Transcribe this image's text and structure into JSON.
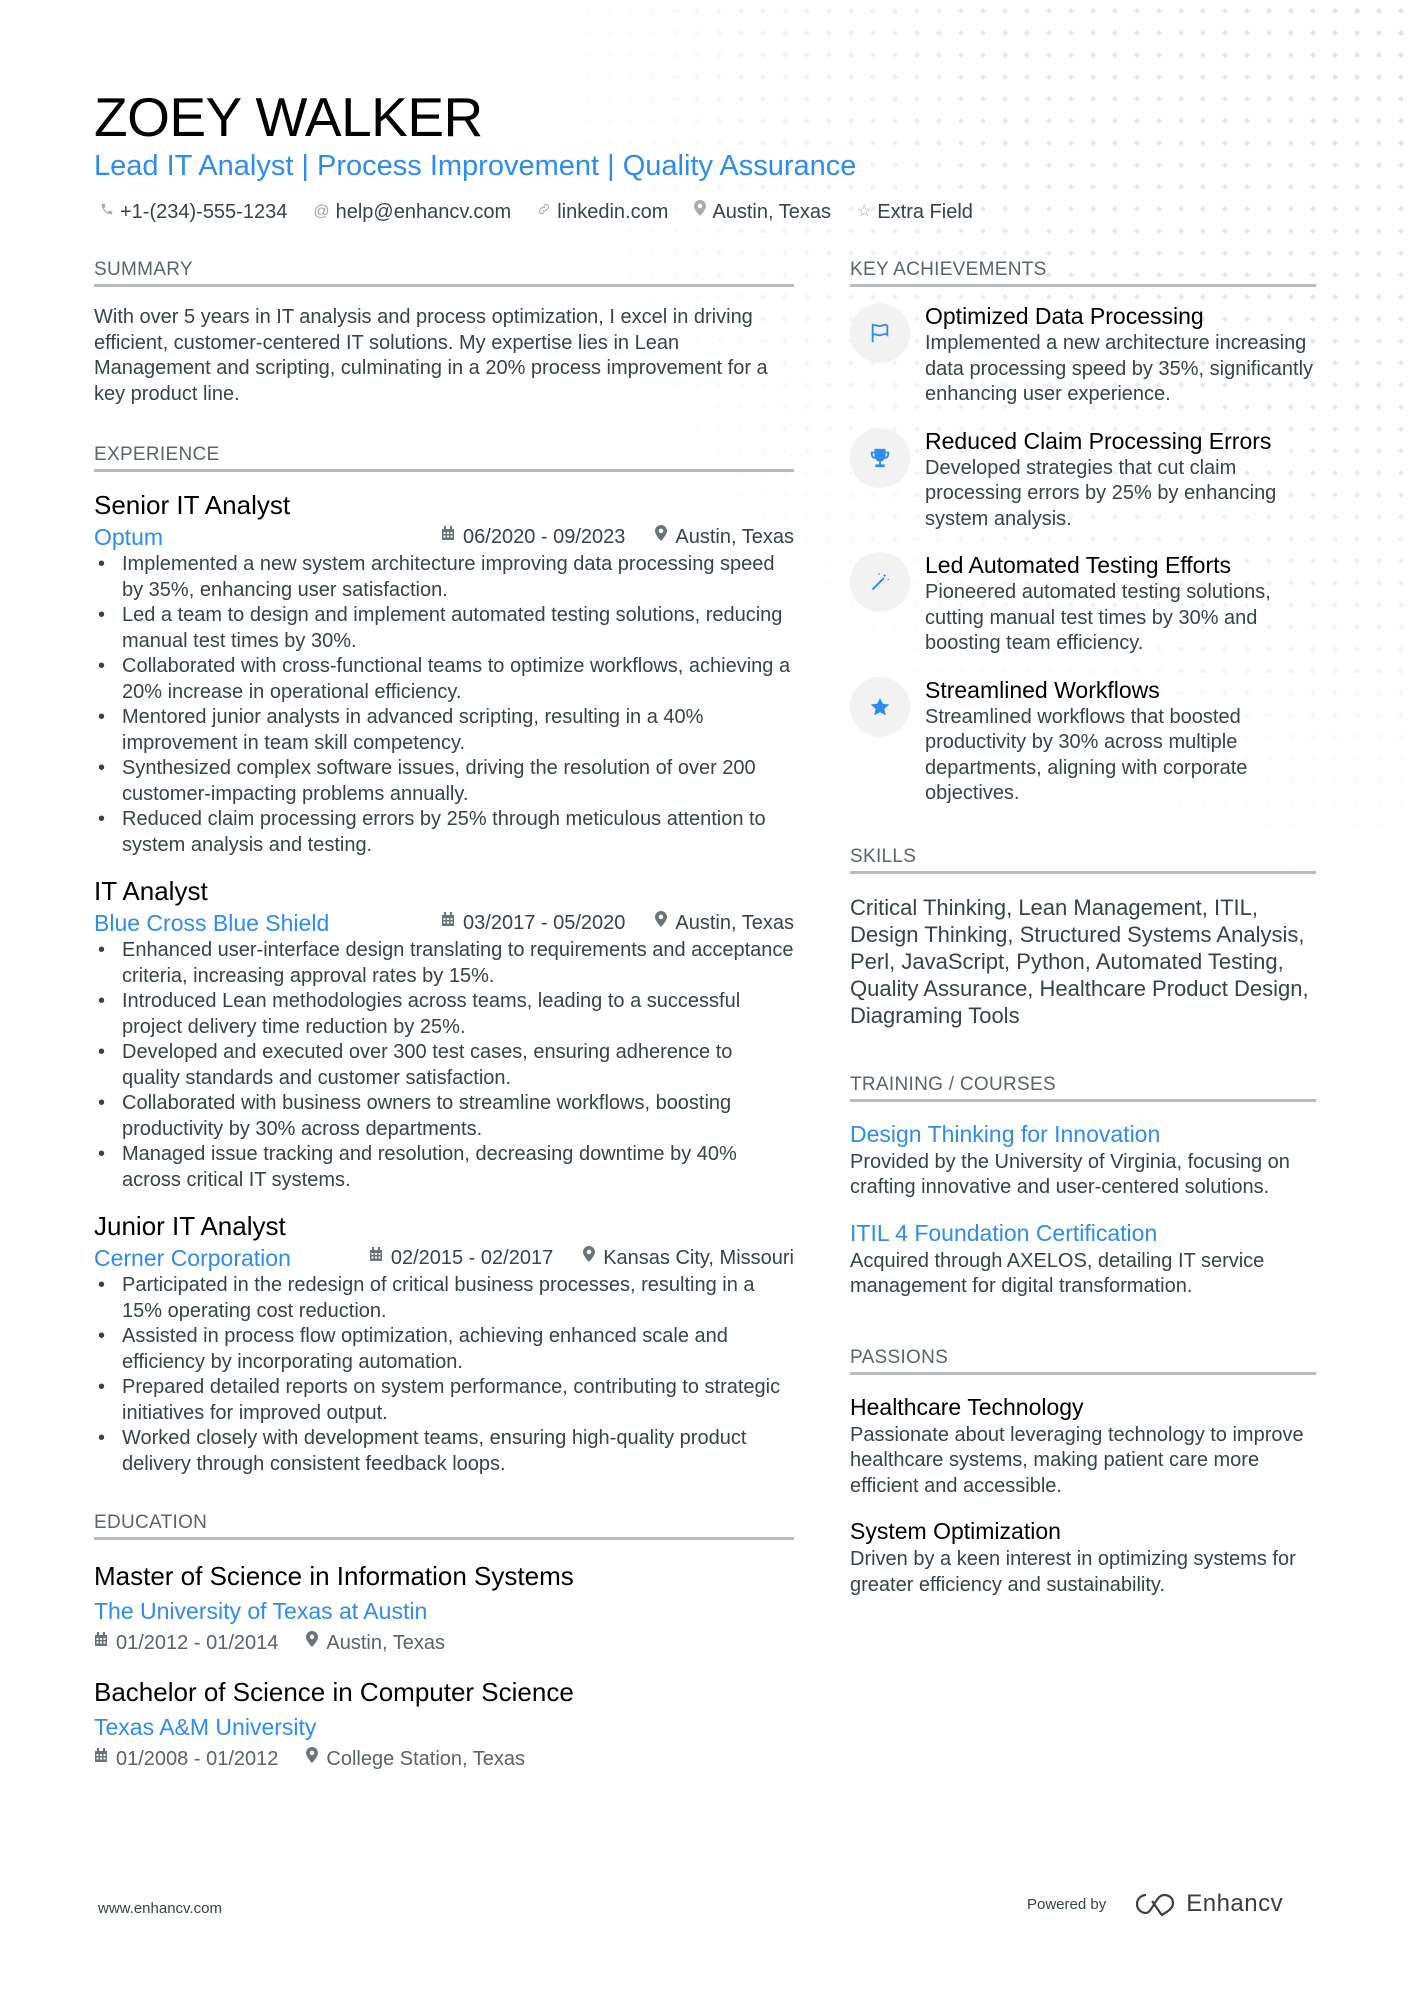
{
  "header": {
    "name": "ZOEY WALKER",
    "headline": "Lead IT Analyst | Process Improvement | Quality Assurance",
    "contacts": [
      {
        "icon": "phone-icon",
        "glyph": "✆",
        "text": "+1-(234)-555-1234"
      },
      {
        "icon": "at-icon",
        "glyph": "@",
        "text": "help@enhancv.com"
      },
      {
        "icon": "link-icon",
        "glyph": "🔗︎",
        "text": "linkedin.com"
      },
      {
        "icon": "location-icon",
        "glyph": "⚲",
        "text": "Austin, Texas"
      },
      {
        "icon": "star-icon",
        "glyph": "☆",
        "text": "Extra Field"
      }
    ]
  },
  "summary": {
    "title": "SUMMARY",
    "text": "With over 5 years in IT analysis and process optimization, I excel in driving efficient, customer-centered IT solutions. My expertise lies in Lean Management and scripting, culminating in a 20% process improvement for a key product line."
  },
  "experience": {
    "title": "EXPERIENCE",
    "jobs": [
      {
        "title": "Senior IT Analyst",
        "company": "Optum",
        "dates": "06/2020 - 09/2023",
        "location": "Austin, Texas",
        "bullets": [
          "Implemented a new system architecture improving data processing speed by 35%, enhancing user satisfaction.",
          "Led a team to design and implement automated testing solutions, reducing manual test times by 30%.",
          "Collaborated with cross-functional teams to optimize workflows, achieving a 20% increase in operational efficiency.",
          "Mentored junior analysts in advanced scripting, resulting in a 40% improvement in team skill competency.",
          "Synthesized complex software issues, driving the resolution of over 200 customer-impacting problems annually.",
          "Reduced claim processing errors by 25% through meticulous attention to system analysis and testing."
        ]
      },
      {
        "title": "IT Analyst",
        "company": "Blue Cross Blue Shield",
        "dates": "03/2017 - 05/2020",
        "location": "Austin, Texas",
        "bullets": [
          "Enhanced user-interface design translating to requirements and acceptance criteria, increasing approval rates by 15%.",
          "Introduced Lean methodologies across teams, leading to a successful project delivery time reduction by 25%.",
          "Developed and executed over 300 test cases, ensuring adherence to quality standards and customer satisfaction.",
          "Collaborated with business owners to streamline workflows, boosting productivity by 30% across departments.",
          "Managed issue tracking and resolution, decreasing downtime by 40% across critical IT systems."
        ]
      },
      {
        "title": "Junior IT Analyst",
        "company": "Cerner Corporation",
        "dates": "02/2015 - 02/2017",
        "location": "Kansas City, Missouri",
        "bullets": [
          "Participated in the redesign of critical business processes, resulting in a 15% operating cost reduction.",
          "Assisted in process flow optimization, achieving enhanced scale and efficiency by incorporating automation.",
          "Prepared detailed reports on system performance, contributing to strategic initiatives for improved output.",
          "Worked closely with development teams, ensuring high-quality product delivery through consistent feedback loops."
        ]
      }
    ]
  },
  "education": {
    "title": "EDUCATION",
    "items": [
      {
        "degree": "Master of Science in Information Systems",
        "school": "The University of Texas at Austin",
        "dates": "01/2012 - 01/2014",
        "location": "Austin, Texas"
      },
      {
        "degree": "Bachelor of Science in Computer Science",
        "school": "Texas A&M University",
        "dates": "01/2008 - 01/2012",
        "location": "College Station, Texas"
      }
    ]
  },
  "achievements": {
    "title": "KEY ACHIEVEMENTS",
    "items": [
      {
        "icon": "flag-icon",
        "title": "Optimized Data Processing",
        "desc": "Implemented a new architecture increasing data processing speed by 35%, significantly enhancing user experience."
      },
      {
        "icon": "trophy-icon",
        "title": "Reduced Claim Processing Errors",
        "desc": "Developed strategies that cut claim processing errors by 25% by enhancing system analysis."
      },
      {
        "icon": "magic-wand-icon",
        "title": "Led Automated Testing Efforts",
        "desc": "Pioneered automated testing solutions, cutting manual test times by 30% and boosting team efficiency."
      },
      {
        "icon": "star-icon",
        "title": "Streamlined Workflows",
        "desc": "Streamlined workflows that boosted productivity by 30% across multiple departments, aligning with corporate objectives."
      }
    ]
  },
  "skills": {
    "title": "SKILLS",
    "text": "Critical Thinking, Lean Management, ITIL, Design Thinking, Structured Systems Analysis, Perl, JavaScript, Python, Automated Testing, Quality Assurance, Healthcare Product Design, Diagraming Tools"
  },
  "training": {
    "title": "TRAINING / COURSES",
    "items": [
      {
        "title": "Design Thinking for Innovation",
        "desc": "Provided by the University of Virginia, focusing on crafting innovative and user-centered solutions."
      },
      {
        "title": "ITIL 4 Foundation Certification",
        "desc": "Acquired through AXELOS, detailing IT service management for digital transformation."
      }
    ]
  },
  "passions": {
    "title": "PASSIONS",
    "items": [
      {
        "title": "Healthcare Technology",
        "desc": "Passionate about leveraging technology to improve healthcare systems, making patient care more efficient and accessible."
      },
      {
        "title": "System Optimization",
        "desc": "Driven by a keen interest in optimizing systems for greater efficiency and sustainability."
      }
    ]
  },
  "footer": {
    "website": "www.enhancv.com",
    "powered_by": "Powered by",
    "brand": "Enhancv"
  },
  "colors": {
    "accent": "#2d8cf0",
    "text": "#384347",
    "heading": "#000000",
    "rule": "#b9bcbf"
  }
}
